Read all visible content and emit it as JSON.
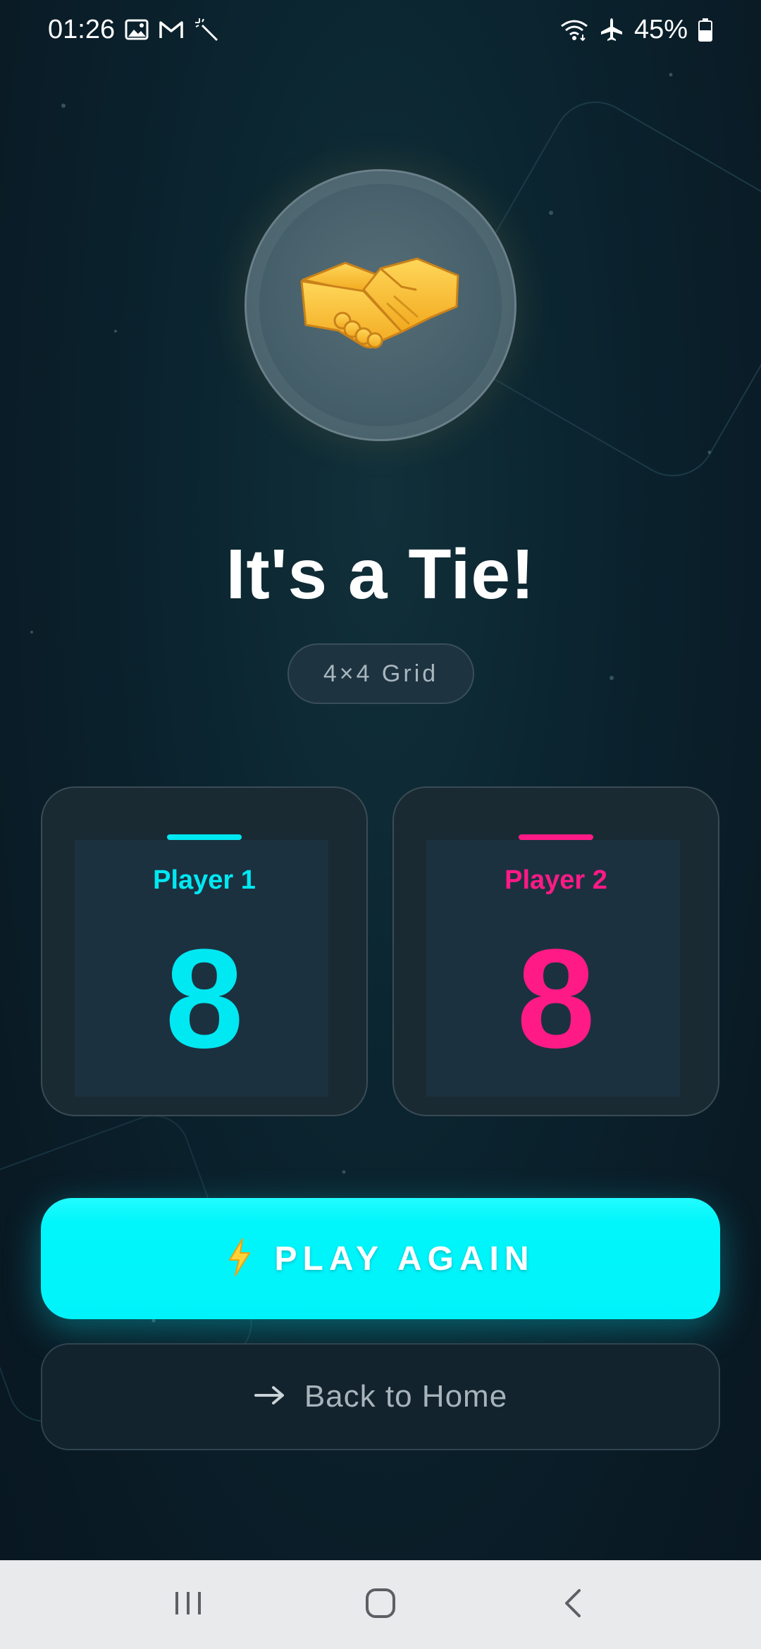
{
  "status_bar": {
    "time": "01:26",
    "battery": "45%",
    "icons_left": [
      "image-icon",
      "gmail-icon",
      "magic-wand-icon"
    ],
    "icons_right": [
      "wifi-icon",
      "airplane-icon",
      "battery-icon"
    ]
  },
  "result": {
    "hero_icon": "handshake-icon",
    "title": "It's a Tie!",
    "grid_label": "4×4 Grid"
  },
  "players": [
    {
      "label": "Player 1",
      "score": "8",
      "color": "#00e8f2"
    },
    {
      "label": "Player 2",
      "score": "8",
      "color": "#ff1a86"
    }
  ],
  "actions": {
    "play_again": {
      "icon": "lightning-icon",
      "label": "PLAY AGAIN"
    },
    "back_home": {
      "icon": "arrow-right-icon",
      "label": "Back to Home"
    }
  },
  "nav_bar": {
    "buttons": [
      "recent-apps-icon",
      "home-icon",
      "back-icon"
    ]
  },
  "colors": {
    "accent_cyan": "#00f3fa",
    "accent_pink": "#ff1a86",
    "background": "#0a1c27"
  }
}
